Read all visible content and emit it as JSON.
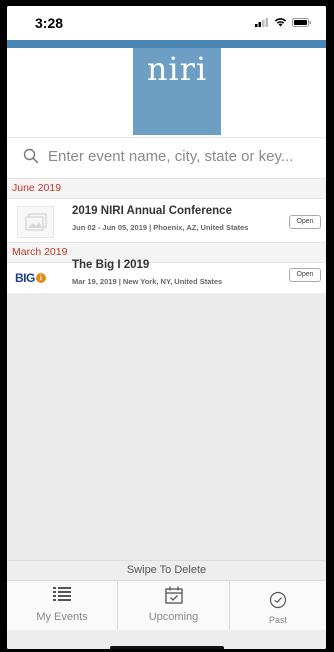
{
  "status_bar": {
    "time": "3:28"
  },
  "colors": {
    "accent": "#4a86b4",
    "logo_bg": "#6d9fc5",
    "section_text": "#c0392b",
    "tab_text": "#888888"
  },
  "header": {
    "logo_text": "niri"
  },
  "search": {
    "placeholder": "Enter event name, city, state or key..."
  },
  "sections": [
    {
      "label": "June 2019",
      "events": [
        {
          "title": "2019 NIRI Annual Conference",
          "meta": "Jun 02 - Jun 05, 2019 | Phoenix, AZ, United States",
          "button": "Open",
          "thumb_icon": "image-placeholder-icon"
        }
      ]
    },
    {
      "label": "March 2019",
      "events": [
        {
          "title": "The Big I 2019",
          "meta": "Mar 19, 2019 | New York, NY, United States",
          "button": "Open",
          "thumb_logo": "BIG"
        }
      ]
    }
  ],
  "swipe_hint": "Swipe To Delete",
  "tabs": [
    {
      "label": "My Events",
      "icon": "list-icon"
    },
    {
      "label": "Upcoming",
      "icon": "calendar-icon"
    },
    {
      "label": "Past",
      "icon": "clock-icon"
    }
  ]
}
